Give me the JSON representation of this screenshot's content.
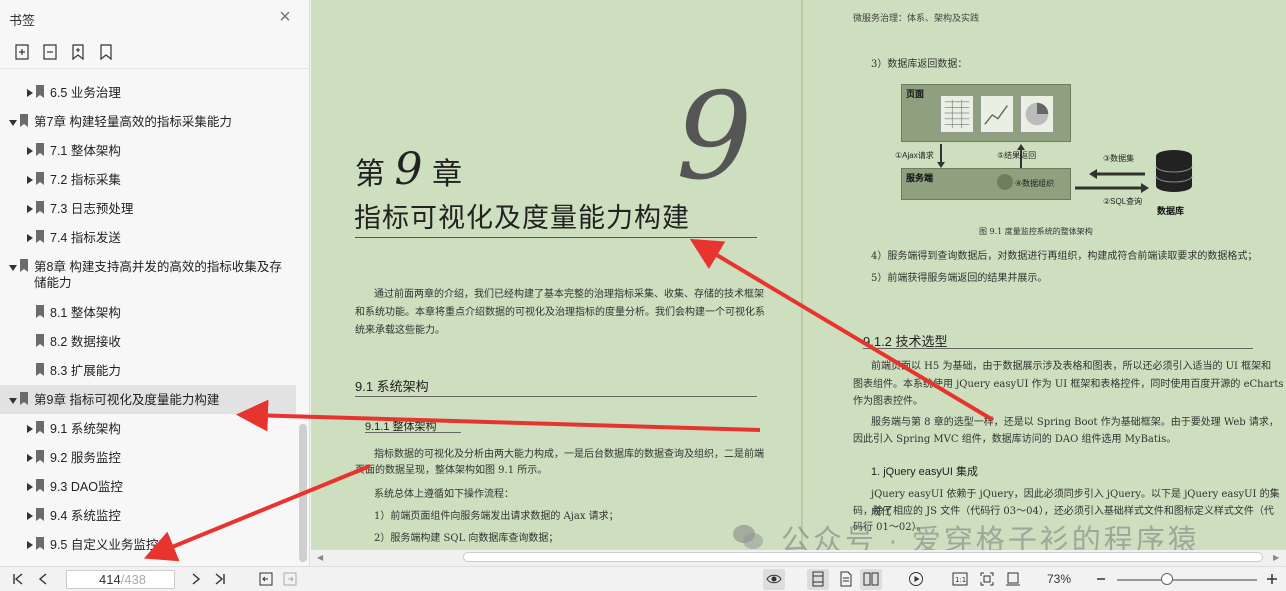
{
  "sidebar": {
    "title": "书签",
    "items": [
      {
        "label": "6.5 业务治理",
        "level": 1
      },
      {
        "label": "第7章 构建轻量高效的指标采集能力",
        "level": 0
      },
      {
        "label": "7.1 整体架构",
        "level": 1
      },
      {
        "label": "7.2 指标采集",
        "level": 1
      },
      {
        "label": "7.3 日志预处理",
        "level": 1
      },
      {
        "label": "7.4 指标发送",
        "level": 1
      },
      {
        "label": "第8章 构建支持高并发的高效的指标收集及存储能力",
        "level": 0
      },
      {
        "label": "8.1 整体架构",
        "level": 1
      },
      {
        "label": "8.2 数据接收",
        "level": 1
      },
      {
        "label": "8.3 扩展能力",
        "level": 1
      },
      {
        "label": "第9章 指标可视化及度量能力构建",
        "level": 0
      },
      {
        "label": "9.1 系统架构",
        "level": 1
      },
      {
        "label": "9.2 服务监控",
        "level": 1
      },
      {
        "label": "9.3 DAO监控",
        "level": 1
      },
      {
        "label": "9.4 系统监控",
        "level": 1
      },
      {
        "label": "9.5 自定义业务监控",
        "level": 1
      }
    ]
  },
  "left_page": {
    "chapter_word_1": "第",
    "chapter_number": "9",
    "chapter_word_2": "章",
    "big_number": "9",
    "chapter_title": "指标可视化及度量能力构建",
    "intro_1": "通过前面两章的介绍，我们已经构建了基本完整的治理指标采集、收集、存储的技术框架",
    "intro_2": "和系统功能。本章将重点介绍数据的可视化及治理指标的度量分析。我们会构建一个可视化系",
    "intro_3": "统来承载这些能力。",
    "section_91": "9.1   系统架构",
    "section_911": "9.1.1   整体架构",
    "p1_1": "指标数据的可视化及分析由两大能力构成，一是后台数据库的数据查询及组织，二是前端",
    "p1_2": "页面的数据呈现，整体架构如图 9.1 所示。",
    "p2": "系统总体上遵循如下操作流程：",
    "p3": "1）前端页面组件向服务端发出请求数据的 Ajax 请求；",
    "p4": "2）服务端构建 SQL 向数据库查询数据；"
  },
  "right_page": {
    "header": "微服务治理：体系、架构及实践",
    "step3": "3）数据库返回数据：",
    "diagram": {
      "page_label": "页面",
      "server_label": "服务端",
      "ajax": "①Ajax请求",
      "result": "⑤结果返回",
      "collect": "③数据集",
      "sql": "②SQL查询",
      "organize": "④数据组织",
      "db": "数据库"
    },
    "fig_caption": "图 9.1    度量监控系统的整体架构",
    "step4": "4）服务端得到查询数据后，对数据进行再组织，构建成符合前端读取要求的数据格式；",
    "step5": "5）前端获得服务端返回的结果并展示。",
    "section_912": "9.1.2   技术选型",
    "t1_1": "前端页面以 H5 为基础，由于数据展示涉及表格和图表，所以还必须引入适当的 UI 框架和",
    "t1_2": "图表组件。本系统使用 jQuery easyUI 作为 UI 框架和表格控件，同时使用百度开源的 eCharts",
    "t1_3": "作为图表控件。",
    "t2_1": "服务端与第 8 章的选型一样，还是以 Spring Boot 作为基础框架。由于要处理 Web 请求，",
    "t2_2": "因此引入 Spring MVC 组件，数据库访问的 DAO 组件选用 MyBatis。",
    "sub1": "1. jQuery easyUI 集成",
    "t3_1": "jQuery easyUI 依赖于 jQuery，因此必须同步引入 jQuery。以下是 jQuery easyUI 的集成代",
    "t3_2": "码，除了相应的 JS 文件（代码行 03～04），还必须引入基础样式文件和图标定义样式文件（代",
    "t3_3": "码行 01～02）。"
  },
  "watermark": "公众号 · 爱穿格子衫的程序猿",
  "statusbar": {
    "current_page": "414",
    "total_pages": "/438",
    "zoom": "73%"
  },
  "colors": {
    "page_bg": "#cddfbf",
    "arrow": "#e8342f",
    "selected": "#e2e2e2"
  }
}
